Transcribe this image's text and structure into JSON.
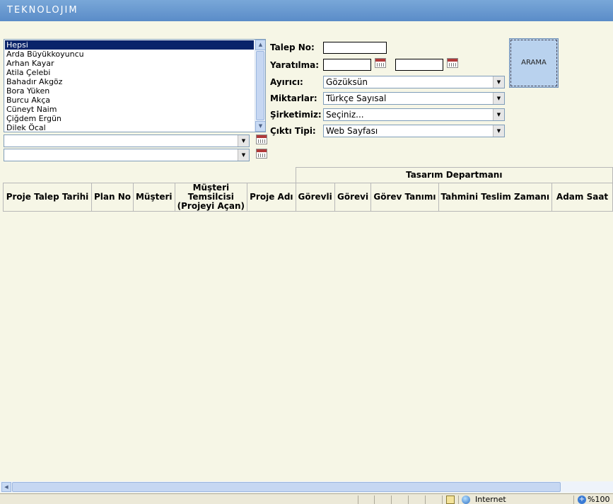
{
  "header": {
    "logo_text": "TEKNOLOJIM"
  },
  "user_list": {
    "items": [
      "Hepsi",
      "Arda Büyükkoyuncu",
      "Arhan Kayar",
      "Atila Çelebi",
      "Bahadır Akgöz",
      "Bora Yüken",
      "Burcu Akça",
      "Cüneyt Naim",
      "Çiğdem Ergün",
      "Dilek Öcal"
    ],
    "selected_index": 0
  },
  "date_selects": [
    {
      "value": ""
    },
    {
      "value": ""
    }
  ],
  "form": {
    "request_no_label": "Talep No:",
    "request_no_value": "",
    "created_label": "Yaratılma:",
    "created_from": "",
    "created_to": "",
    "separator_label": "Ayırıcı:",
    "separator_value": "Gözüksün",
    "amounts_label": "Miktarlar:",
    "amounts_value": "Türkçe Sayısal",
    "company_label": "Şirketimiz:",
    "company_value": "Seçiniz...",
    "output_label": "Çıktı Tipi:",
    "output_value": "Web Sayfası"
  },
  "search_button": {
    "label": "ARAMA"
  },
  "table": {
    "group_header": "Tasarım Departmanı",
    "columns": [
      "Proje Talep Tarihi",
      "Plan No",
      "Müşteri",
      "Müşteri Temsilcisi\n(Projeyi Açan)",
      "Proje Adı",
      "Görevli",
      "Görevi",
      "Görev Tanımı",
      "Tahmini Teslim Zamanı",
      "Adam Saat"
    ]
  },
  "status_bar": {
    "zone": "Internet",
    "zoom": "%100"
  },
  "colors": {
    "header_bg": "#5a8cc8",
    "page_bg": "#f6f6e6",
    "selected_bg": "#0a246a"
  },
  "icons": [
    "calendar-icon",
    "lock-icon",
    "globe-icon",
    "zoom-icon"
  ]
}
